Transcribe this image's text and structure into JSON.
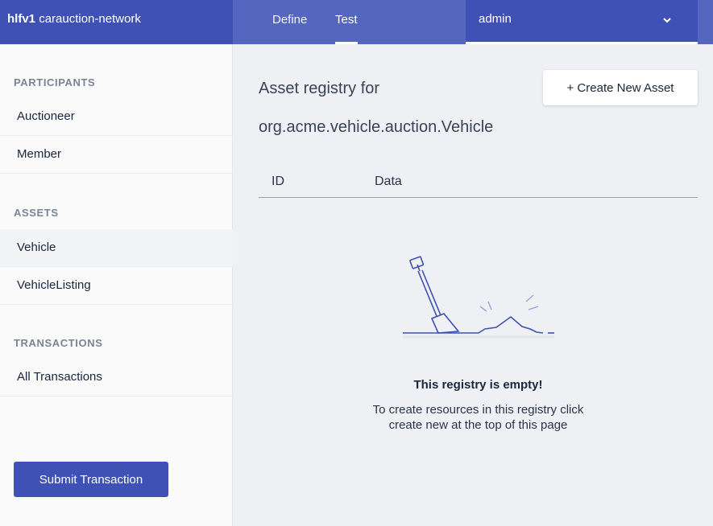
{
  "header": {
    "brand_bold": "hlfv1",
    "brand_name": "carauction-network",
    "tabs": [
      {
        "label": "Define"
      },
      {
        "label": "Test"
      }
    ],
    "user": "admin"
  },
  "sidebar": {
    "participants_label": "PARTICIPANTS",
    "participants": [
      {
        "label": "Auctioneer"
      },
      {
        "label": "Member"
      }
    ],
    "assets_label": "ASSETS",
    "assets": [
      {
        "label": "Vehicle"
      },
      {
        "label": "VehicleListing"
      }
    ],
    "transactions_label": "TRANSACTIONS",
    "transactions": [
      {
        "label": "All Transactions"
      }
    ],
    "submit_label": "Submit Transaction"
  },
  "main": {
    "title_line1": "Asset registry for",
    "title_line2": "org.acme.vehicle.auction.Vehicle",
    "create_label": "+ Create New Asset",
    "columns": [
      "ID",
      "Data"
    ],
    "empty_title": "This registry is empty!",
    "empty_desc_line1": "To create resources in this registry click",
    "empty_desc_line2": "create new at the top of this page"
  },
  "colors": {
    "primary": "#3f51b5",
    "header_bar": "#5466c0",
    "background": "#eff0f4"
  }
}
